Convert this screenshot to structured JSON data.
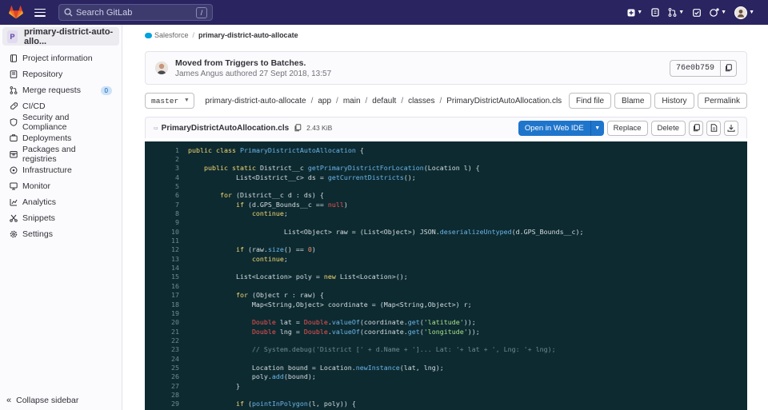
{
  "navbar": {
    "search_placeholder": "Search GitLab",
    "search_shortcut": "/"
  },
  "sidebar": {
    "project_initial": "P",
    "project_name": "primary-district-auto-allo...",
    "items": [
      {
        "label": "Project information",
        "icon": "info-icon"
      },
      {
        "label": "Repository",
        "icon": "repository-icon"
      },
      {
        "label": "Merge requests",
        "icon": "merge-request-icon",
        "badge": "0"
      },
      {
        "label": "CI/CD",
        "icon": "rocket-icon"
      },
      {
        "label": "Security and Compliance",
        "icon": "shield-icon"
      },
      {
        "label": "Deployments",
        "icon": "deployments-icon"
      },
      {
        "label": "Packages and registries",
        "icon": "package-icon"
      },
      {
        "label": "Infrastructure",
        "icon": "cloud-icon"
      },
      {
        "label": "Monitor",
        "icon": "monitor-icon"
      },
      {
        "label": "Analytics",
        "icon": "analytics-icon"
      },
      {
        "label": "Snippets",
        "icon": "snippet-icon"
      },
      {
        "label": "Settings",
        "icon": "gear-icon"
      }
    ],
    "collapse_label": "Collapse sidebar"
  },
  "breadcrumb": {
    "group": "Salesforce",
    "project": "primary-district-auto-allocate"
  },
  "commit": {
    "title": "Moved from Triggers to Batches.",
    "subtitle": "James Angus authored 27 Sept 2018, 13:57",
    "sha": "76e0b759"
  },
  "file_nav": {
    "branch": "master",
    "path": [
      "primary-district-auto-allocate",
      "app",
      "main",
      "default",
      "classes",
      "PrimaryDistrictAutoAllocation.cls"
    ],
    "buttons": {
      "find": "Find file",
      "blame": "Blame",
      "history": "History",
      "permalink": "Permalink"
    }
  },
  "file_header": {
    "filename": "PrimaryDistrictAutoAllocation.cls",
    "size": "2.43 KiB",
    "open_ide": "Open in Web IDE",
    "replace": "Replace",
    "delete": "Delete"
  },
  "code": {
    "line_numbers": [
      "1",
      "2",
      "3",
      "4",
      "5",
      "6",
      "7",
      "8",
      "9",
      "10",
      "11",
      "12",
      "13",
      "14",
      "15",
      "16",
      "17",
      "18",
      "19",
      "20",
      "21",
      "22",
      "23",
      "24",
      "25",
      "26",
      "27",
      "28",
      "29"
    ],
    "lines": [
      "public class PrimaryDistrictAutoAllocation {",
      "",
      "    public static District__c getPrimaryDistrictForLocation(Location l) {",
      "            List<District__c> ds = getCurrentDistricts();",
      "",
      "        for (District__c d : ds) {",
      "            if (d.GPS_Bounds__c == null)",
      "                continue;",
      "",
      "                        List<Object> raw = (List<Object>) JSON.deserializeUntyped(d.GPS_Bounds__c);",
      "",
      "            if (raw.size() == 0)",
      "                continue;",
      "",
      "            List<Location> poly = new List<Location>();",
      "",
      "            for (Object r : raw) {",
      "                Map<String,Object> coordinate = (Map<String,Object>) r;",
      "",
      "                Double lat = Double.valueOf(coordinate.get('latitude'));",
      "                Double lng = Double.valueOf(coordinate.get('longitude'));",
      "",
      "                // System.debug('District [' + d.Name + ']... Lat: '+ lat + ', Lng: '+ lng);",
      "",
      "                Location bound = Location.newInstance(lat, lng);",
      "                poly.add(bound);",
      "            }",
      "",
      "            if (pointInPolygon(l, poly)) {"
    ]
  }
}
